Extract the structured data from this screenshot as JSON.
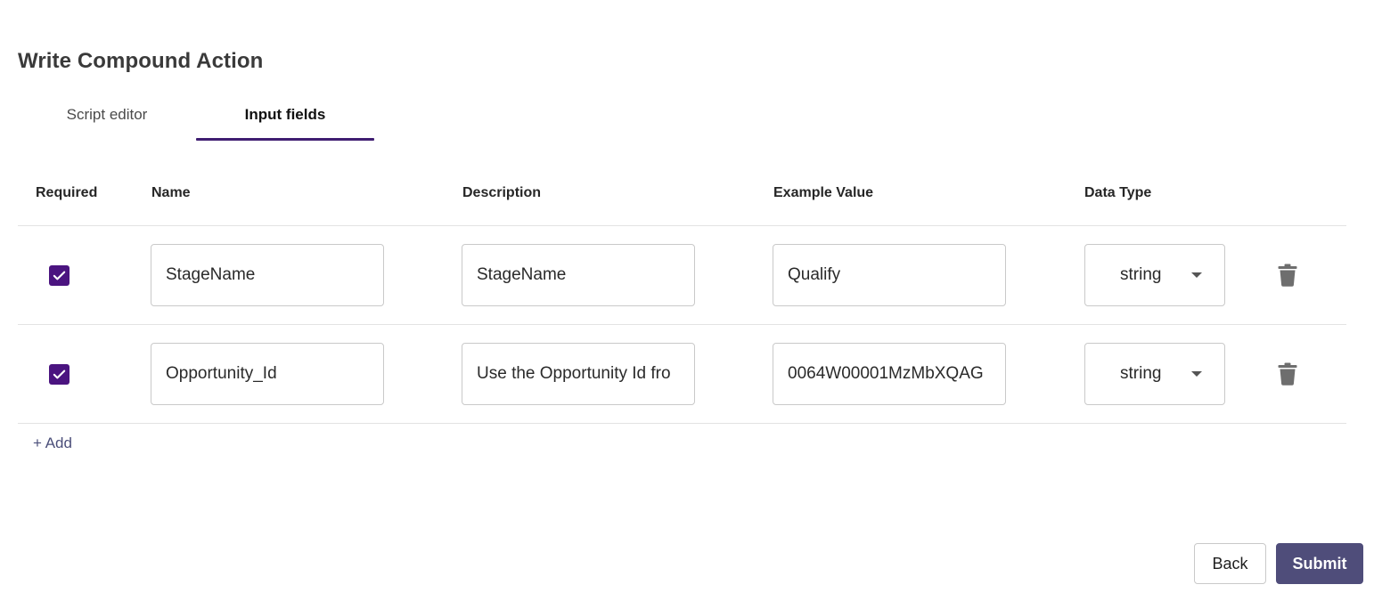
{
  "page": {
    "title": "Write Compound Action"
  },
  "tabs": [
    {
      "label": "Script editor",
      "active": false
    },
    {
      "label": "Input fields",
      "active": true
    }
  ],
  "table": {
    "headers": {
      "required": "Required",
      "name": "Name",
      "description": "Description",
      "example": "Example Value",
      "datatype": "Data Type"
    },
    "rows": [
      {
        "required": true,
        "name": "StageName",
        "description": "StageName",
        "example": "Qualify",
        "datatype": "string"
      },
      {
        "required": true,
        "name": "Opportunity_Id",
        "description": "Use the Opportunity Id fro",
        "example": "0064W00001MzMbXQAG",
        "datatype": "string"
      }
    ]
  },
  "actions": {
    "add_label": "+ Add",
    "back_label": "Back",
    "submit_label": "Submit"
  },
  "colors": {
    "accent": "#3f1d71",
    "checkbox": "#4b1480",
    "submit_bg": "#4f4d7a",
    "add_text": "#4b4f7a"
  },
  "icons": {
    "checkbox": "check-icon",
    "delete": "trash-icon",
    "select": "caret-down-icon"
  }
}
